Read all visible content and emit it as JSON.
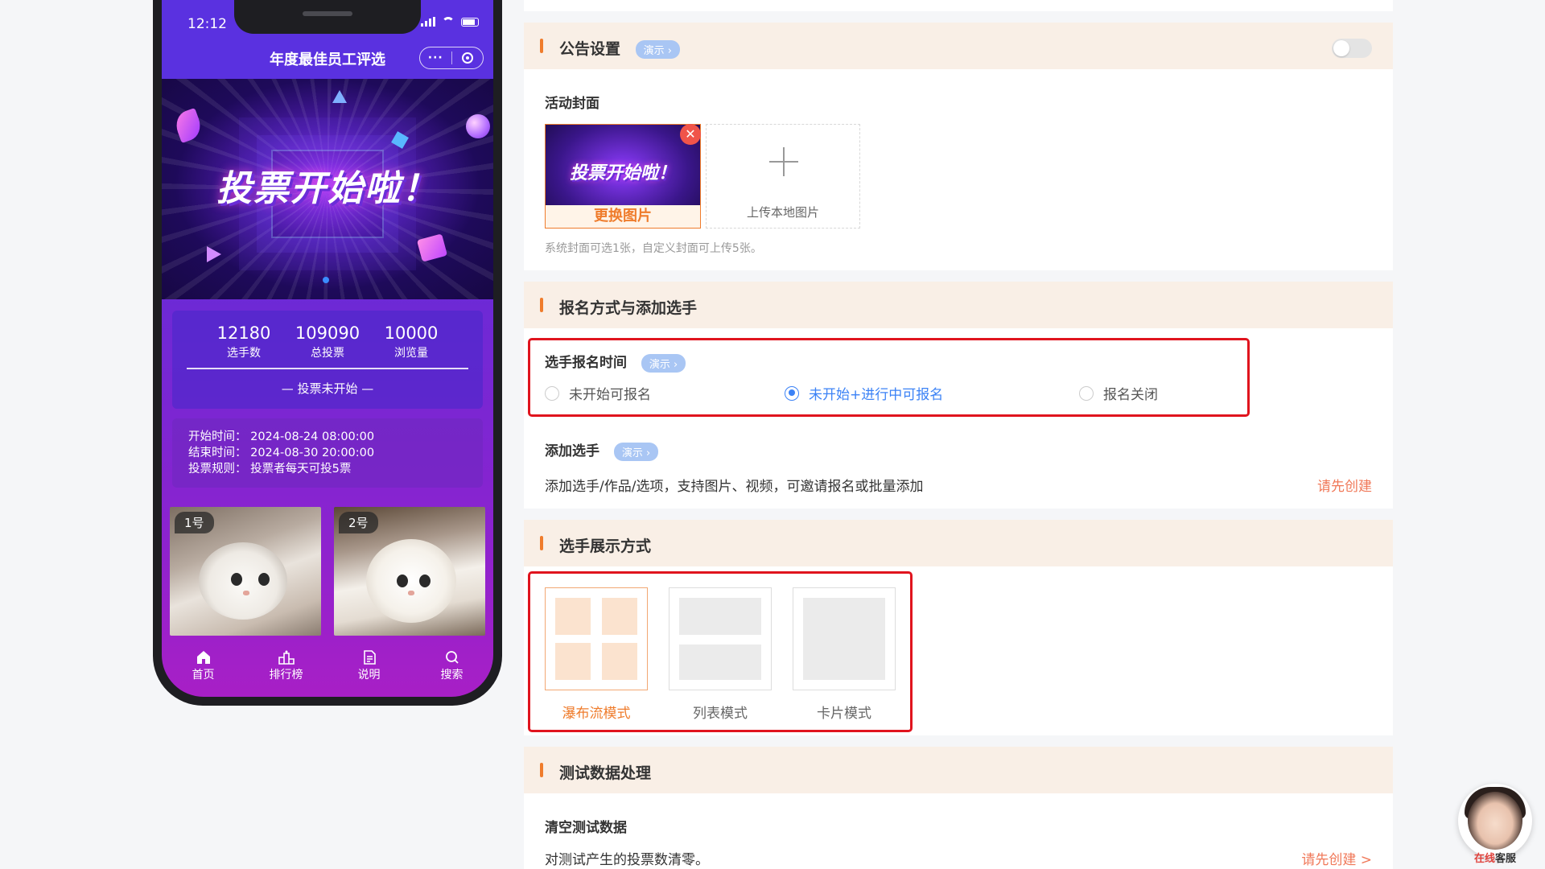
{
  "phone": {
    "status_time": "12:12",
    "nav_title": "年度最佳员工评选",
    "capsule_more": "···",
    "banner_text": "投票开始啦！",
    "stats": [
      {
        "num": "12180",
        "label": "选手数"
      },
      {
        "num": "109090",
        "label": "总投票"
      },
      {
        "num": "10000",
        "label": "浏览量"
      }
    ],
    "vote_status": "— 投票未开始 —",
    "info": {
      "start": "开始时间： 2024-08-24 08:00:00",
      "end": "结束时间： 2024-08-30 20:00:00",
      "rule": "投票规则： 投票者每天可投5票"
    },
    "contestants": [
      {
        "badge": "1号"
      },
      {
        "badge": "2号"
      }
    ],
    "tabs": [
      {
        "label": "首页",
        "icon": "home-icon"
      },
      {
        "label": "排行榜",
        "icon": "ranking-icon"
      },
      {
        "label": "说明",
        "icon": "document-icon"
      },
      {
        "label": "搜索",
        "icon": "search-icon"
      }
    ]
  },
  "announcement": {
    "title": "公告设置",
    "demo": "演示 ›",
    "toggle_on": false
  },
  "cover": {
    "label": "活动封面",
    "thumb_text": "投票开始啦！",
    "change_label": "更换图片",
    "close": "✕",
    "upload_label": "上传本地图片",
    "hint": "系统封面可选1张，自定义封面可上传5张。"
  },
  "signup": {
    "title": "报名方式与添加选手",
    "time_label": "选手报名时间",
    "demo": "演示 ›",
    "options": [
      {
        "label": "未开始可报名",
        "checked": false
      },
      {
        "label": "未开始+进行中可报名",
        "checked": true
      },
      {
        "label": "报名关闭",
        "checked": false
      }
    ],
    "add_label": "添加选手",
    "add_demo": "演示 ›",
    "add_desc": "添加选手/作品/选项，支持图片、视频，可邀请报名或批量添加",
    "add_link": "请先创建"
  },
  "display": {
    "title": "选手展示方式",
    "modes": [
      {
        "label": "瀑布流模式",
        "active": true
      },
      {
        "label": "列表模式",
        "active": false
      },
      {
        "label": "卡片模式",
        "active": false
      }
    ]
  },
  "test_data": {
    "title": "测试数据处理",
    "clear_label": "清空测试数据",
    "clear_desc": "对测试产生的投票数清零。",
    "link": "请先创建 >"
  },
  "customer_service": {
    "label_accent": "在线",
    "label_rest": "客服"
  },
  "colors": {
    "accent_orange": "#ef7c2c",
    "section_bg": "#f9efe6",
    "highlight_red": "#e0141e",
    "selected_blue": "#3b82f6",
    "demo_tag": "#a9c6f4",
    "link_orange": "#f07858"
  }
}
